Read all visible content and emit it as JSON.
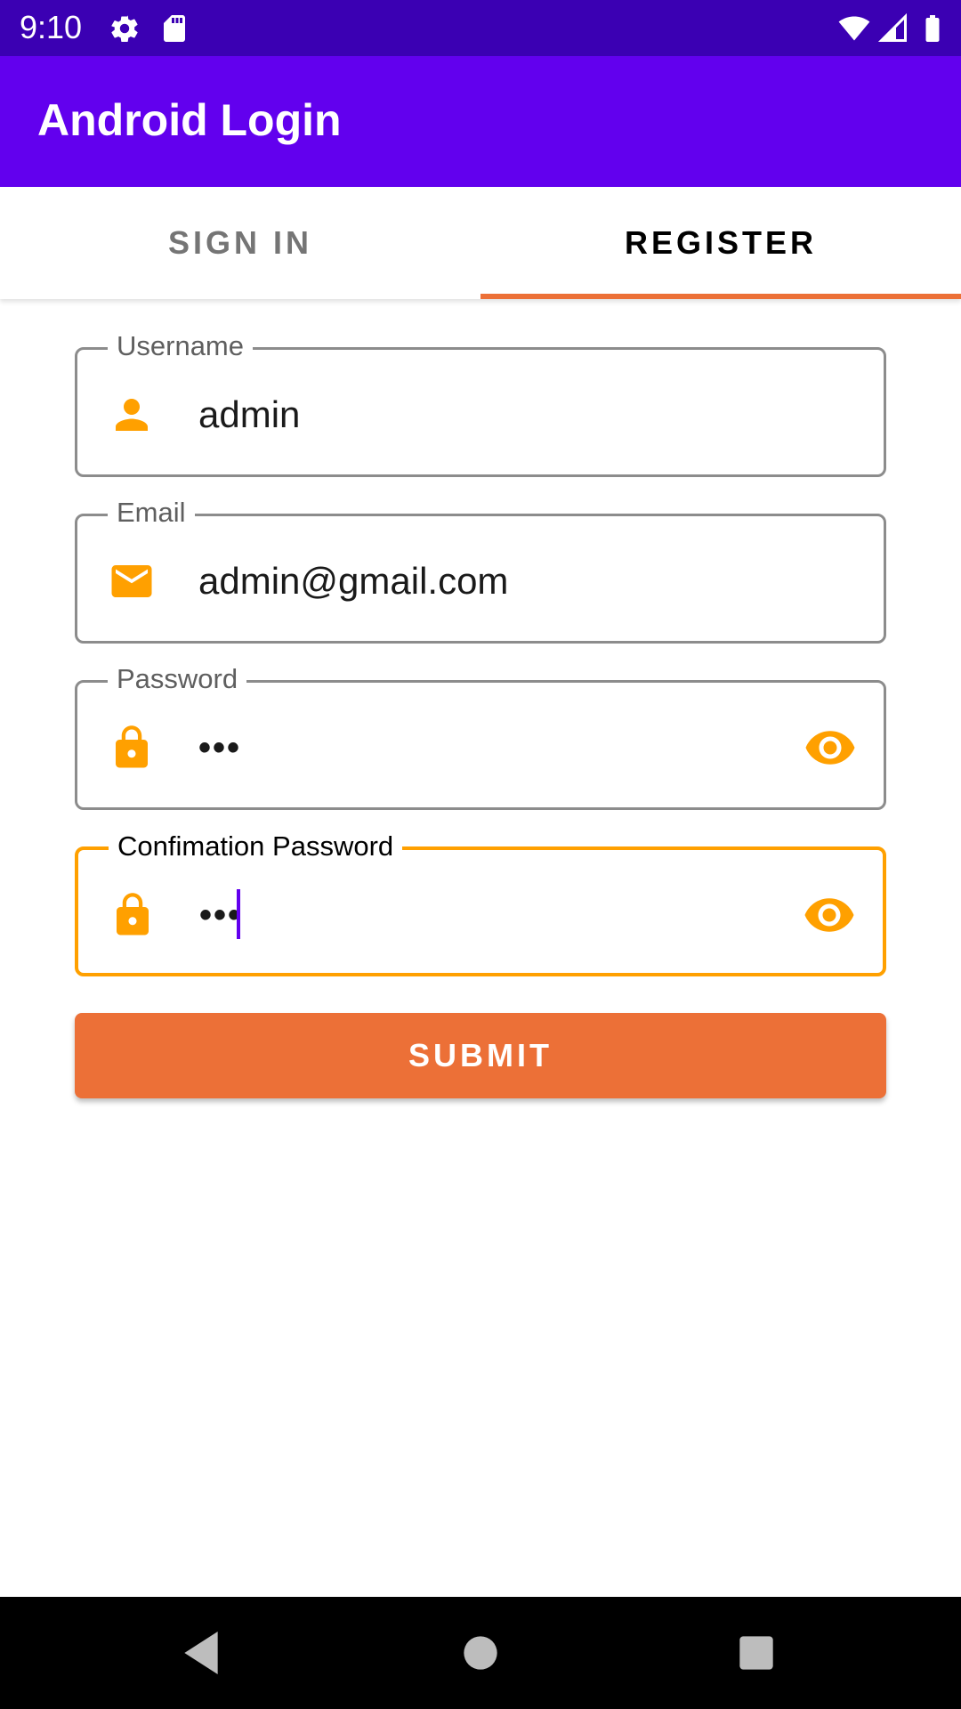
{
  "status_bar": {
    "time": "9:10",
    "icons": [
      "gear-icon",
      "sd-card-icon",
      "wifi-icon",
      "signal-icon",
      "battery-icon"
    ]
  },
  "app_bar": {
    "title": "Android Login"
  },
  "tabs": [
    {
      "label": "SIGN IN",
      "selected": false
    },
    {
      "label": "REGISTER",
      "selected": true
    }
  ],
  "form": {
    "username": {
      "label": "Username",
      "value": "admin",
      "icon": "person-icon"
    },
    "email": {
      "label": "Email",
      "value": "admin@gmail.com",
      "icon": "email-icon"
    },
    "password": {
      "label": "Password",
      "value": "•••",
      "icon": "lock-icon",
      "toggle_icon": "eye-icon"
    },
    "confirm_password": {
      "label": "Confimation Password",
      "value": "•••",
      "icon": "lock-icon",
      "toggle_icon": "eye-icon",
      "focused": true
    },
    "submit_label": "SUBMIT"
  },
  "nav_bar": {
    "icons": [
      "back-icon",
      "home-icon",
      "recents-icon"
    ]
  },
  "colors": {
    "status_bar": "#3b00b3",
    "app_bar": "#6200ee",
    "accent": "#ec7037",
    "icon": "#ffa000",
    "cursor": "#6200ee"
  }
}
